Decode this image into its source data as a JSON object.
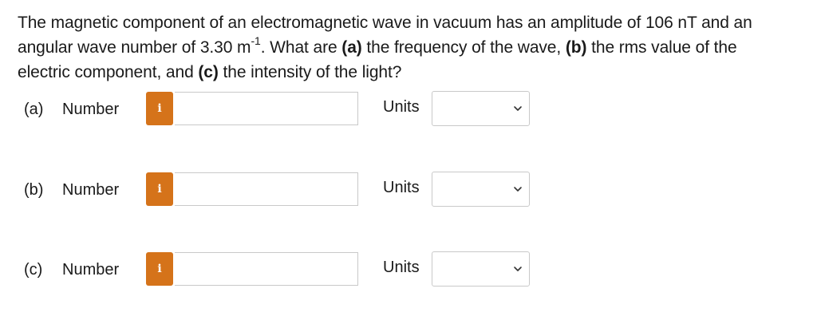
{
  "question": {
    "text_1": "The magnetic component of an electromagnetic wave in vacuum has an amplitude of 106 nT and an angular wave number of 3.30 m",
    "superscript": "-1",
    "text_2": ". What are ",
    "part_a_tag": "(a)",
    "text_3": " the frequency of the wave, ",
    "part_b_tag": "(b)",
    "text_4": " the rms value of the electric component, and ",
    "part_c_tag": "(c)",
    "text_5": " the intensity of the light?"
  },
  "answers": [
    {
      "part_label": "(a)",
      "number_label": "Number",
      "info_icon": "i",
      "number_value": "",
      "units_label": "Units",
      "units_value": ""
    },
    {
      "part_label": "(b)",
      "number_label": "Number",
      "info_icon": "i",
      "number_value": "",
      "units_label": "Units",
      "units_value": ""
    },
    {
      "part_label": "(c)",
      "number_label": "Number",
      "info_icon": "i",
      "number_value": "",
      "units_label": "Units",
      "units_value": ""
    }
  ],
  "colors": {
    "info_button": "#d5731a",
    "input_border": "#c9c9c9",
    "text": "#1a1a1a"
  },
  "icons": {
    "info": "info-icon",
    "dropdown": "chevron-down-icon"
  }
}
